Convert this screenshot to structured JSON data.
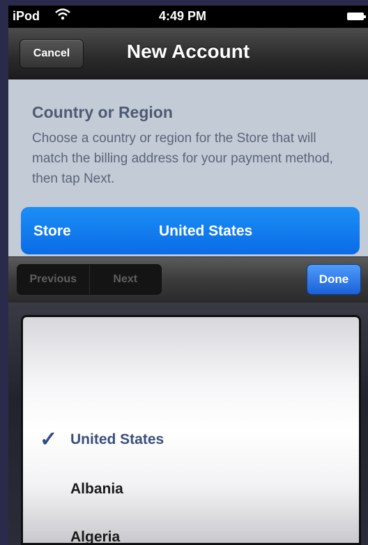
{
  "status_bar": {
    "carrier": "iPod",
    "time": "4:49 PM",
    "wifi_icon": "wifi-icon",
    "battery_icon": "battery-icon"
  },
  "nav_bar": {
    "cancel_label": "Cancel",
    "title": "New Account"
  },
  "section": {
    "title": "Country or Region",
    "description": "Choose a country or region for the Store that will match the billing address for your payment method, then tap Next."
  },
  "store_row": {
    "label": "Store",
    "value": "United States"
  },
  "toolbar": {
    "previous_label": "Previous",
    "next_label": "Next",
    "done_label": "Done"
  },
  "picker": {
    "items": [
      {
        "label": "United States",
        "selected": true
      },
      {
        "label": "Albania",
        "selected": false
      },
      {
        "label": "Algeria",
        "selected": false
      }
    ]
  },
  "colors": {
    "store_row_blue": "#0a6be6",
    "done_blue": "#1b61d8",
    "content_bg": "#c3cbd6",
    "checkmark": "#2f4a86"
  }
}
